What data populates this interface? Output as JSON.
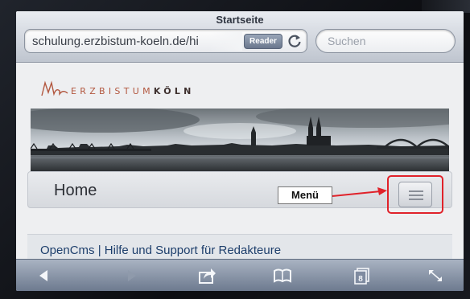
{
  "browser": {
    "page_title": "Startseite",
    "url": "schulung.erzbistum-koeln.de/hi",
    "reader_label": "Reader",
    "search_placeholder": "Suchen"
  },
  "site": {
    "logo_text_light": "ERZBISTUM",
    "logo_text_bold": "KÖLN",
    "nav_title": "Home",
    "callout_label": "Menü",
    "subtitle": "OpenCms | Hilfe und Support für Redakteure"
  },
  "toolbar": {
    "tab_count": "8",
    "icons": [
      "back-icon",
      "forward-icon",
      "share-icon",
      "bookmarks-icon",
      "tabs-icon",
      "fullscreen-icon"
    ]
  },
  "colors": {
    "highlight": "#e0222a",
    "logo_accent": "#b2573f"
  }
}
